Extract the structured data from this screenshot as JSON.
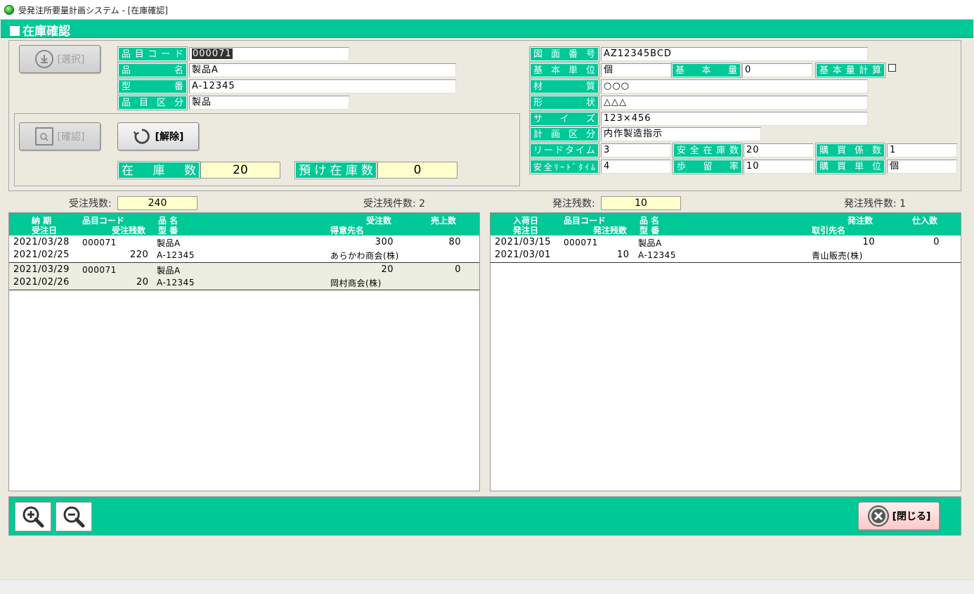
{
  "window": {
    "title": "受発注所要量計画システム - [在庫確認]"
  },
  "banner": {
    "title": "在庫確認"
  },
  "buttons": {
    "select": "[選択]",
    "confirm": "[確認]",
    "release": "[解除]",
    "close": "[閉じる]"
  },
  "item": {
    "code_label": "品目コード",
    "code": "000071",
    "name_label": "品名",
    "name": "製品A",
    "model_label": "型番",
    "model": "A-12345",
    "category_label": "品目区分",
    "category": "製品"
  },
  "spec": {
    "drawing_label": "図面番号",
    "drawing": "AZ12345BCD",
    "unit_label": "基本単位",
    "unit": "個",
    "basic_qty_label": "基本量",
    "basic_qty": "0",
    "basic_calc_label": "基本量計算",
    "material_label": "材質",
    "material": "○○○",
    "shape_label": "形状",
    "shape": "△△△",
    "size_label": "サイズ",
    "size": "123×456",
    "plan_label": "計画区分",
    "plan": "内作製造指示",
    "lead_label": "リードタイム",
    "lead": "3",
    "safety_stock_label": "安全在庫数",
    "safety_stock": "20",
    "purchase_factor_label": "購買係数",
    "purchase_factor": "1",
    "safety_lead_label": "安全ﾘｰﾄﾞﾀｲﾑ",
    "safety_lead": "4",
    "yield_label": "歩留率",
    "yield": "10",
    "purchase_unit_label": "購買単位",
    "purchase_unit": "個"
  },
  "stock": {
    "stock_label": "在庫数",
    "stock": "20",
    "deposit_label": "預け在庫数",
    "deposit": "0"
  },
  "orders": {
    "remaining_label": "受注残数:",
    "remaining": "240",
    "count_label": "受注残件数:",
    "count": "2",
    "headers": {
      "due": "納 期",
      "order_date": "受注日",
      "code": "品目コード",
      "remain": "受注残数",
      "name": "品 名",
      "model": "型 番",
      "qty": "受注数",
      "customer": "得意先名",
      "sales": "売上数"
    },
    "rows": [
      {
        "due": "2021/03/28",
        "code": "000071",
        "name": "製品A",
        "qty": "300",
        "sales": "80",
        "order_date": "2021/02/25",
        "remain": "220",
        "model": "A-12345",
        "customer": "あらかわ商会(株)"
      },
      {
        "due": "2021/03/29",
        "code": "000071",
        "name": "製品A",
        "qty": "20",
        "sales": "0",
        "order_date": "2021/02/26",
        "remain": "20",
        "model": "A-12345",
        "customer": "岡村商会(株)"
      }
    ]
  },
  "purchases": {
    "remaining_label": "発注残数:",
    "remaining": "10",
    "count_label": "発注残件数:",
    "count": "1",
    "headers": {
      "arrival": "入荷日",
      "order_date": "発注日",
      "code": "品目コード",
      "remain": "発注残数",
      "name": "品 名",
      "model": "型 番",
      "qty": "発注数",
      "supplier": "取引先名",
      "received": "仕入数"
    },
    "rows": [
      {
        "arrival": "2021/03/15",
        "code": "000071",
        "name": "製品A",
        "qty": "10",
        "received": "0",
        "order_date": "2021/03/01",
        "remain": "10",
        "model": "A-12345",
        "supplier": "青山販売(株)"
      }
    ]
  },
  "colors": {
    "accent": "#00c896",
    "highlight": "#ffffcc"
  }
}
